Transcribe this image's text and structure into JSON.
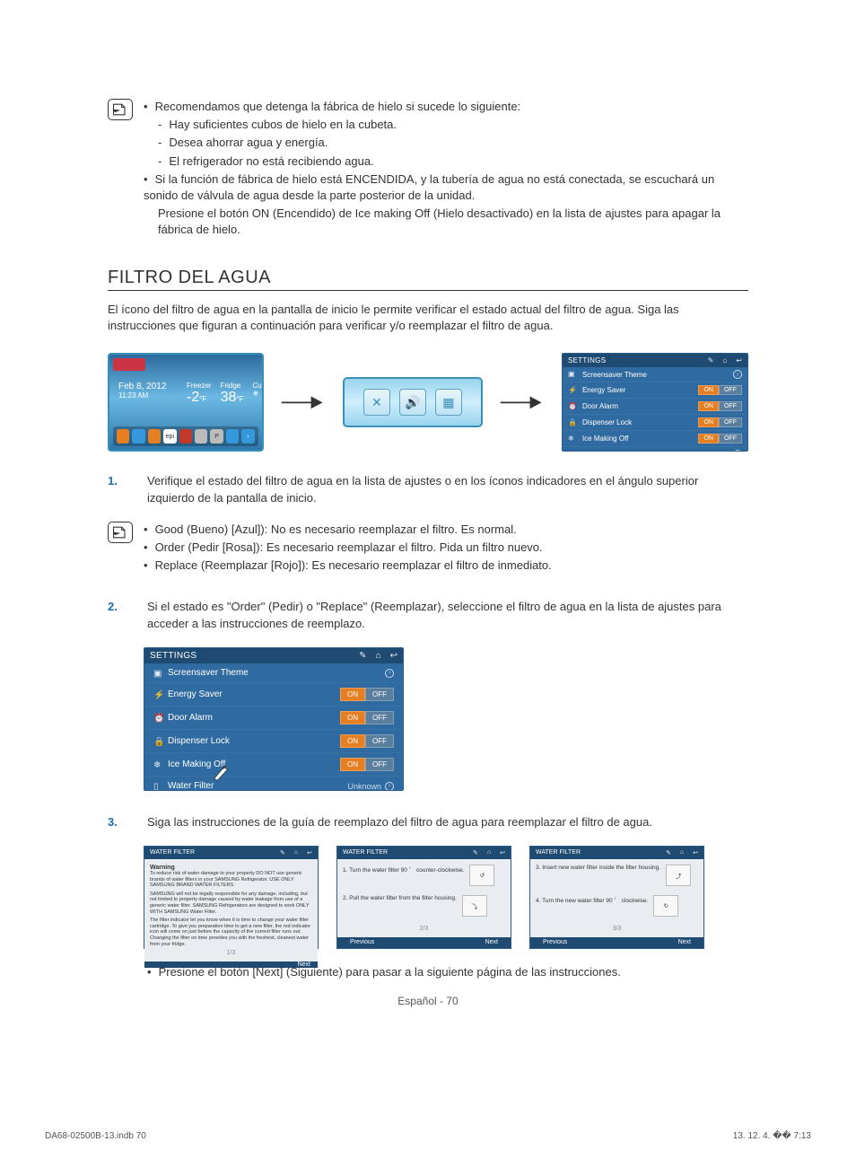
{
  "top_note": {
    "b1": "Recomendamos que detenga la fábrica de hielo si sucede lo siguiente:",
    "d1": "Hay suficientes cubos de hielo en la cubeta.",
    "d2": "Desea ahorrar agua y energía.",
    "d3": "El refrigerador no está recibiendo agua.",
    "b2": "Si la función de fábrica de hielo está ENCENDIDA, y la tubería de agua no está conectada, se escuchará un sonido de válvula de agua desde la parte posterior de la unidad.",
    "b2_cont": "Presione el botón ON (Encendido) de Ice making Off (Hielo desactivado) en la lista de ajustes para apagar la fábrica de hielo."
  },
  "section_title": "FILTRO DEL AGUA",
  "intro": "El ícono del filtro de agua en la pantalla de inicio le permite verificar el estado actual del filtro de agua. Siga las instrucciones que figuran a continuación para verificar y/o reemplazar el filtro de agua.",
  "home": {
    "date": "Feb 8, 2012",
    "time": "11:23 AM",
    "t1_label": "Freezer",
    "t1": "-2",
    "t1_unit": "°F",
    "t2_label": "Fridge",
    "t2": "38",
    "t2_unit": "°F",
    "t3_label": "Cubed",
    "dock_epi": "epi",
    "dock_p": "P"
  },
  "settings": {
    "title": "SETTINGS",
    "rows": [
      {
        "label": "Screensaver Theme",
        "type": "nav"
      },
      {
        "label": "Energy Saver",
        "type": "toggle",
        "on": "ON",
        "off": "OFF"
      },
      {
        "label": "Door Alarm",
        "type": "toggle",
        "on": "ON",
        "off": "OFF"
      },
      {
        "label": "Dispenser Lock",
        "type": "toggle",
        "on": "ON",
        "off": "OFF"
      },
      {
        "label": "Ice Making Off",
        "type": "toggle",
        "on": "ON",
        "off": "OFF"
      },
      {
        "label": "Water Filter",
        "type": "status",
        "status": "Unknown"
      }
    ]
  },
  "step1": "Verifique el estado del filtro de agua en la lista de ajustes o en los íconos indicadores en el ángulo superior izquierdo de la pantalla de inicio.",
  "status_note": {
    "g": "Good (Bueno) [Azul]): No es necesario reemplazar el filtro. Es normal.",
    "o": "Order (Pedir [Rosa]): Es necesario reemplazar el filtro. Pida un filtro nuevo.",
    "r": "Replace (Reemplazar [Rojo]): Es necesario reemplazar el filtro de inmediato."
  },
  "step2": "Si el estado es \"Order\" (Pedir) o \"Replace\" (Reemplazar), seleccione el filtro de agua en la lista de ajustes para acceder a las instrucciones de reemplazo.",
  "step3": "Siga las instrucciones de la guía de reemplazo del filtro de agua para reemplazar el filtro de agua.",
  "wf": {
    "title": "WATER FILTER",
    "warning_h": "Warning",
    "warning_p1": "To reduce risk of water damage to your property DO NOT use generic brands of water filters in your SAMSUNG Refrigerator. USE ONLY SAMSUNG BRAND WATER FILTERS.",
    "warning_p2": "SAMSUNG will not be legally responsible for any damage, including, but not limited to property damage caused by water leakage from use of a generic water filter. SAMSUNG Refrigerators are designed to work ONLY WITH SAMSUNG Water Filter.",
    "warning_p3": "The filter indicator let you know when it is time to change your water filter cartridge. To give you preparation time to get a new filter, the red indicator icon will come on just before the capacity of the current filter runs out. Changing the filter on time provides you with the freshest, cleanest water from your fridge.",
    "pg1": "1/3",
    "s1": "1. Turn the water filter 90 ゜ counter-clockwise.",
    "s2": "2. Pull the water filter from the filter housing.",
    "pg2": "2/3",
    "s3": "3. Insert new water filter inside the filter housing.",
    "s4": "4. Turn the new water filter 90 ゜ clockwise.",
    "pg3": "3/3",
    "next": "Next",
    "prev": "Previous"
  },
  "step3_note": "Presione el botón [Next] (Siguiente) para pasar a la siguiente página de las instrucciones.",
  "page_footer": "Español - 70",
  "doc_footer_left": "DA68-02500B-13.indb   70",
  "doc_footer_right": "13. 12. 4.   �� 7:13"
}
